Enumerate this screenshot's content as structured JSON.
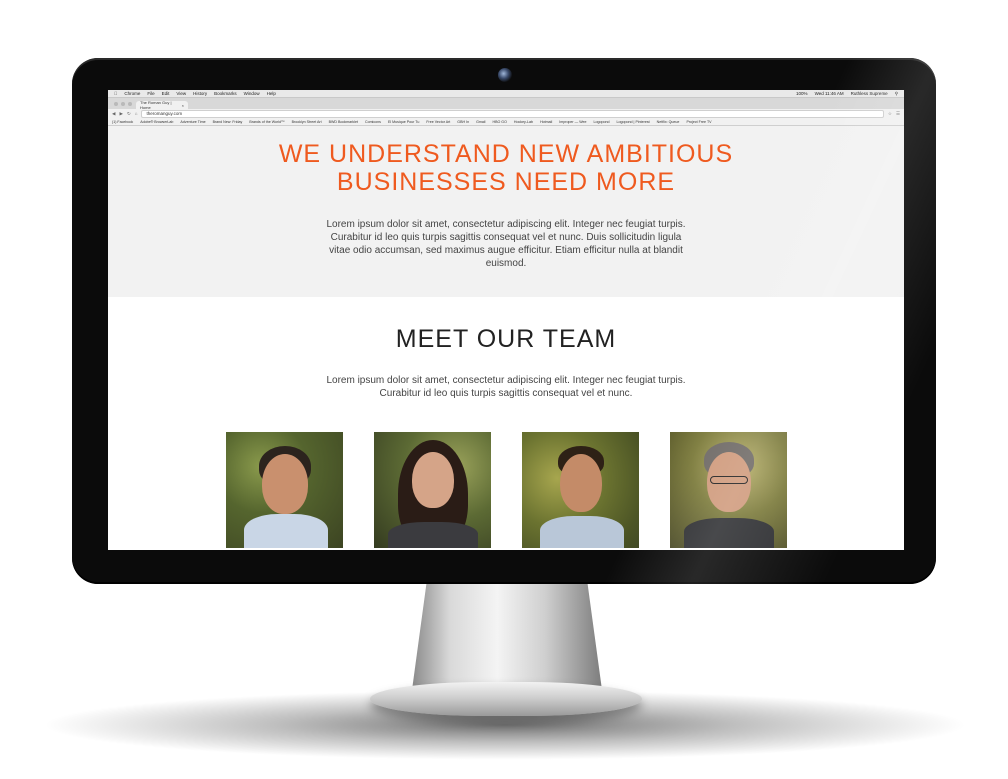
{
  "browser": {
    "menubar": [
      "Chrome",
      "File",
      "Edit",
      "View",
      "History",
      "Bookmarks",
      "Window",
      "Help"
    ],
    "menubar_right": [
      "100%",
      "Wed 11:46 AM",
      "Ruthless Supreme"
    ],
    "tab_title": "The Roman Guy | Home",
    "url": "theromanguy.com",
    "bookmarks": [
      "(1) Facebook",
      "Adobe® BrowserLab",
      "Adventure Time",
      "Brand New: Friday",
      "Brands of the World™",
      "Brooklyn Street Art",
      "BWD Bookmarklet",
      "Comicons",
      "El Musique Pour Tu",
      "Free Vector Art",
      "GBH In",
      "Gmail",
      "HBO GO",
      "Hockey-Lab",
      "Hotmail",
      "Improper — Wee",
      "Logopond",
      "Logopond | Pinterest",
      "Netflix: Queue",
      "Project Free TV"
    ]
  },
  "hero": {
    "title_line1": "WE UNDERSTAND NEW AMBITIOUS",
    "title_line2": "BUSINESSES NEED MORE",
    "body": "Lorem ipsum dolor sit amet, consectetur adipiscing elit. Integer nec feugiat turpis. Curabitur id leo quis turpis sagittis consequat vel et nunc. Duis sollicitudin ligula vitae odio accumsan, sed maximus augue efficitur. Etiam efficitur nulla at blandit euismod."
  },
  "team": {
    "title": "MEET OUR TEAM",
    "body": "Lorem ipsum dolor sit amet, consectetur adipiscing elit. Integer nec feugiat turpis. Curabitur id leo quis turpis sagittis consequat vel et nunc.",
    "members": [
      {
        "name": ""
      },
      {
        "name": ""
      },
      {
        "name": ""
      },
      {
        "name": ""
      }
    ]
  },
  "colors": {
    "accent": "#ef5a1f",
    "hero_bg": "#f2f2f2",
    "bezel": "#0b0b0b"
  }
}
